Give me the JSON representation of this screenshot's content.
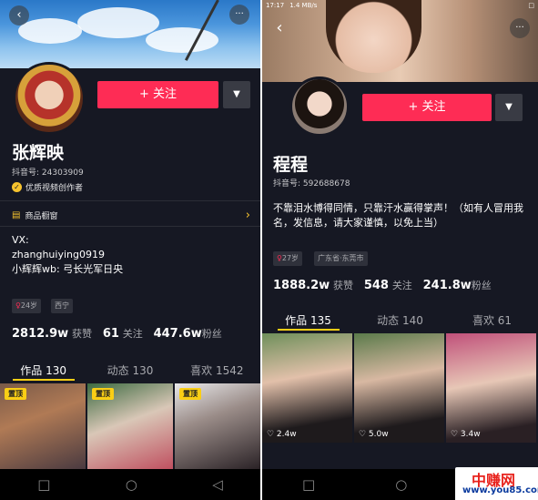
{
  "left": {
    "follow_label": "+ 关注",
    "name": "张辉映",
    "douyin_id": "抖音号: 24303909",
    "certification": "优质视频创作者",
    "shop_label": "商品橱窗",
    "bio_lines": [
      "VX:",
      "zhanghuiying0919",
      "小辉辉wb: 弓长光军日央"
    ],
    "tags": [
      "24岁",
      "西宁"
    ],
    "stats": {
      "likes": "2812.9w",
      "likes_label": "获赞",
      "following": "61",
      "following_label": "关注",
      "fans": "447.6w",
      "fans_label": "粉丝"
    },
    "tabs": [
      "作品 130",
      "动态 130",
      "喜欢 1542"
    ],
    "pinned_label": "置顶"
  },
  "right": {
    "status_time": "17:17",
    "status_info": "1.4 MB/s",
    "status_battery": "□",
    "follow_label": "+ 关注",
    "name": "程程",
    "douyin_id": "抖音号: 592688678",
    "bio": "不靠泪水博得同情，只靠汗水赢得掌声！（如有人冒用我名，发信息，请大家谨慎，以免上当）",
    "tags": [
      "27岁",
      "广东省·东莞市"
    ],
    "stats": {
      "likes": "1888.2w",
      "likes_label": "获赞",
      "following": "548",
      "following_label": "关注",
      "fans": "241.8w",
      "fans_label": "粉丝"
    },
    "tabs": [
      "作品 135",
      "动态 140",
      "喜欢 61"
    ],
    "video_likes": [
      "♡ 2.4w",
      "♡ 5.0w",
      "♡ 3.4w"
    ]
  },
  "nav": {
    "square": "□",
    "circle": "○",
    "back": "◁"
  },
  "icons": {
    "back": "‹",
    "more": "···",
    "dropdown": "▼",
    "chevron": "›",
    "gender": "♀",
    "check": "✓",
    "shop": "▤"
  },
  "watermark": {
    "title": "中赚网",
    "url": "www.you85.com"
  },
  "colors": {
    "background": "#161823",
    "accent": "#fe2c55",
    "highlight": "#face15"
  }
}
